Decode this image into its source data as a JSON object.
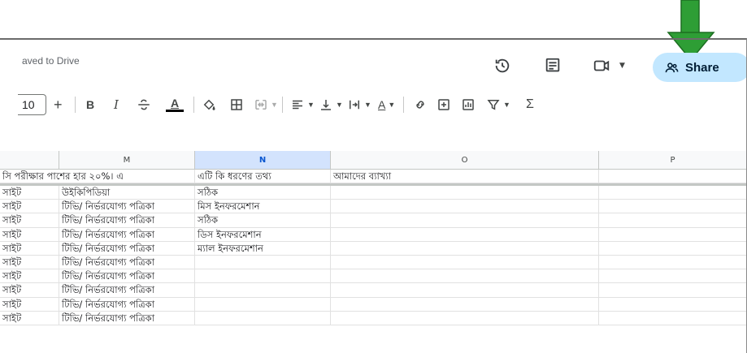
{
  "window": {
    "saved_status": "aved to Drive",
    "share_label": "Share"
  },
  "header_icons": [
    "history-icon",
    "comments-icon",
    "meet-icon",
    "chevron-down-icon",
    "people-icon"
  ],
  "toolbar": {
    "font_size": "10",
    "increase_font": "+",
    "bold": "B",
    "italic": "I",
    "sum": "Σ"
  },
  "columns": {
    "m": "M",
    "n": "N",
    "o": "O",
    "p": "P"
  },
  "header_row": {
    "a": "সি পরীক্ষার পাশের হার ২০%। এ",
    "m": "এটি কি ধরণের তথ্য",
    "n": "আমাদের ব্যাখ্যা"
  },
  "rows": [
    {
      "a": "সাইট",
      "m": "উইকিপিডিয়া",
      "n": "সঠিক"
    },
    {
      "a": "সাইট",
      "m": "টিভি/ নির্ভরযোগ্য পত্রিকা",
      "n": "মিস ইনফরমেশান"
    },
    {
      "a": "সাইট",
      "m": "টিভি/ নির্ভরযোগ্য পত্রিকা",
      "n": "সঠিক"
    },
    {
      "a": "সাইট",
      "m": "টিভি/ নির্ভরযোগ্য পত্রিকা",
      "n": "ডিস ইনফরমেশান"
    },
    {
      "a": "সাইট",
      "m": "টিভি/ নির্ভরযোগ্য পত্রিকা",
      "n": "ম্যাল ইনফরমেশান"
    },
    {
      "a": "সাইট",
      "m": "টিভি/ নির্ভরযোগ্য পত্রিকা",
      "n": ""
    },
    {
      "a": "সাইট",
      "m": "টিভি/ নির্ভরযোগ্য পত্রিকা",
      "n": ""
    },
    {
      "a": "সাইট",
      "m": "টিভি/ নির্ভরযোগ্য পত্রিকা",
      "n": ""
    },
    {
      "a": "সাইট",
      "m": "টিভি/ নির্ভরযোগ্য পত্রিকা",
      "n": ""
    },
    {
      "a": "সাইট",
      "m": "টিভি/ নির্ভরযোগ্য পত্রিকা",
      "n": ""
    }
  ],
  "colors": {
    "share_bg": "#c2e7ff",
    "selected_header": "#d3e3fd",
    "annotation_arrow": "#2e9e35"
  }
}
